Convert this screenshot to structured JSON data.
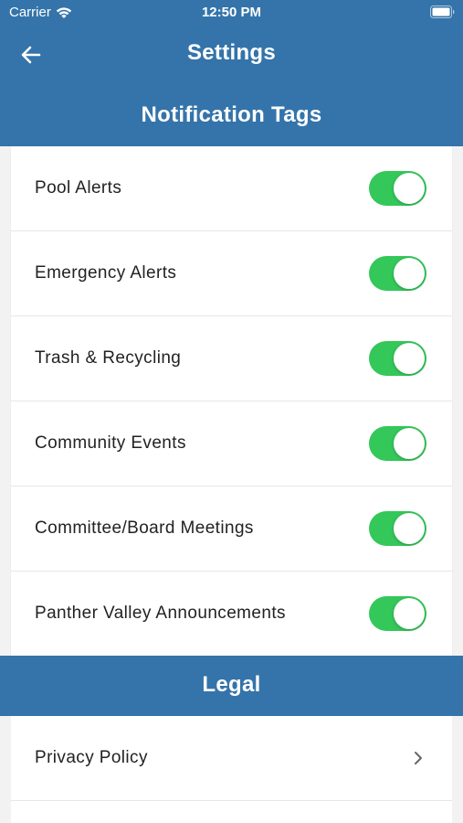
{
  "status_bar": {
    "carrier": "Carrier",
    "time": "12:50 PM"
  },
  "nav": {
    "title": "Settings",
    "back_icon": "arrow-left-icon"
  },
  "sections": {
    "notification_title": "Notification Tags",
    "legal_title": "Legal"
  },
  "notification_tags": [
    {
      "label": "Pool Alerts",
      "enabled": true
    },
    {
      "label": "Emergency Alerts",
      "enabled": true
    },
    {
      "label": "Trash & Recycling",
      "enabled": true
    },
    {
      "label": "Community Events",
      "enabled": true
    },
    {
      "label": "Committee/Board Meetings",
      "enabled": true
    },
    {
      "label": "Panther Valley Announcements",
      "enabled": true
    }
  ],
  "legal_items": [
    {
      "label": "Privacy Policy",
      "icon": "chevron-right-icon"
    }
  ],
  "colors": {
    "header_blue": "#3474aa",
    "toggle_green": "#34c759",
    "background": "#f2f2f2"
  }
}
